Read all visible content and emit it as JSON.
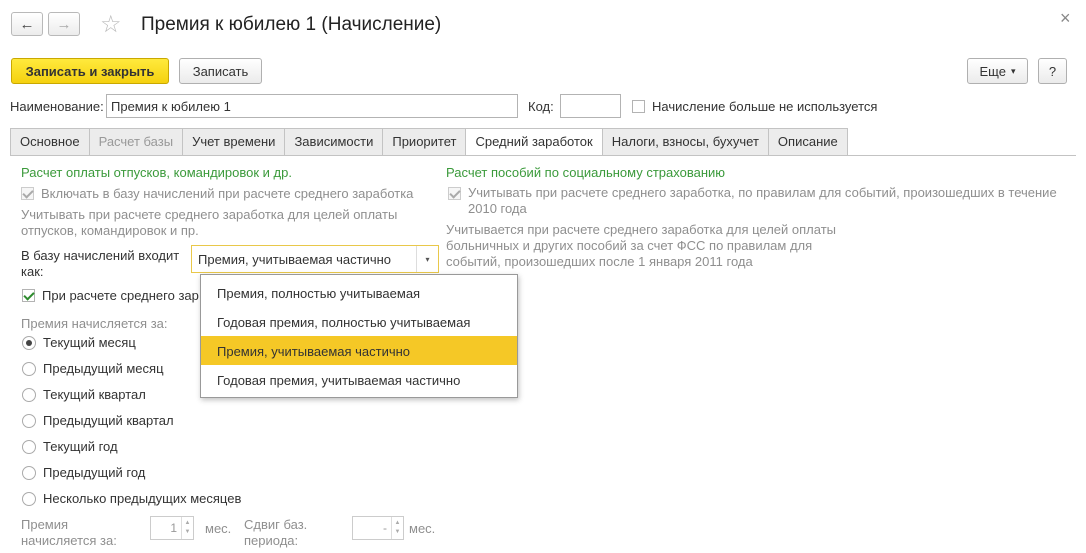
{
  "window": {
    "title": "Премия к юбилею 1 (Начисление)",
    "back_icon": "←",
    "forward_icon": "→",
    "star_icon": "☆",
    "close_icon": "×"
  },
  "toolbar": {
    "save_close_label": "Записать и закрыть",
    "save_label": "Записать",
    "more_label": "Еще",
    "more_arrow": "▾",
    "help_label": "?"
  },
  "header": {
    "name_label": "Наименование:",
    "name_value": "Премия к юбилею 1",
    "code_label": "Код:",
    "code_value": "",
    "unused_label": "Начисление больше не используется"
  },
  "tabs": [
    {
      "label": "Основное"
    },
    {
      "label": "Расчет базы"
    },
    {
      "label": "Учет времени"
    },
    {
      "label": "Зависимости"
    },
    {
      "label": "Приоритет"
    },
    {
      "label": "Средний заработок"
    },
    {
      "label": "Налоги, взносы, бухучет"
    },
    {
      "label": "Описание"
    }
  ],
  "left": {
    "heading": "Расчет оплаты отпусков, командировок и др.",
    "include_label": "Включать в базу начислений при расчете среднего заработка",
    "note_line1": "Учитывать при расчете среднего заработка для целей оплаты",
    "note_line2": "отпусков, командировок и пр.",
    "base_label_line1": "В базу начислений входит",
    "base_label_line2": "как:",
    "base_value": "Премия, учитываемая частично",
    "base_arrow": "▾",
    "calc_label": "При расчете среднего зар",
    "accrued_for_label": "Премия начисляется за:",
    "periods": [
      {
        "label": "Текущий месяц"
      },
      {
        "label": "Предыдущий месяц"
      },
      {
        "label": "Текущий квартал"
      },
      {
        "label": "Предыдущий квартал"
      },
      {
        "label": "Текущий год"
      },
      {
        "label": "Предыдущий год"
      },
      {
        "label": "Несколько предыдущих месяцев"
      }
    ],
    "selected_period": "Текущий месяц",
    "months_label_line1": "Премия",
    "months_label_line2": "начисляется за:",
    "months_value": "1",
    "months_unit": "мес.",
    "shift_label_line1": "Сдвиг баз.",
    "shift_label_line2": "периода:",
    "shift_value": "-",
    "shift_unit": "мес."
  },
  "right": {
    "heading": "Расчет пособий по социальному страхованию",
    "consider_line1": "Учитывать при расчете среднего заработка, по правилам для событий, произошедших в течение",
    "consider_line2": "2010 года",
    "note_line1": "Учитывается при расчете среднего заработка для целей оплаты",
    "note_line2": "больничных и других пособий за счет ФСС по правилам для",
    "note_line3": "событий, произошедших после 1 января 2011 года"
  },
  "dropdown": {
    "options": [
      {
        "label": "Премия, полностью учитываемая"
      },
      {
        "label": "Годовая премия, полностью учитываемая"
      },
      {
        "label": "Премия, учитываемая частично"
      },
      {
        "label": "Годовая премия, учитываемая частично"
      }
    ],
    "selected": "Премия, учитываемая частично"
  },
  "colors": {
    "accent_yellow": "#f5c826",
    "heading_green": "#3b9a3b"
  }
}
